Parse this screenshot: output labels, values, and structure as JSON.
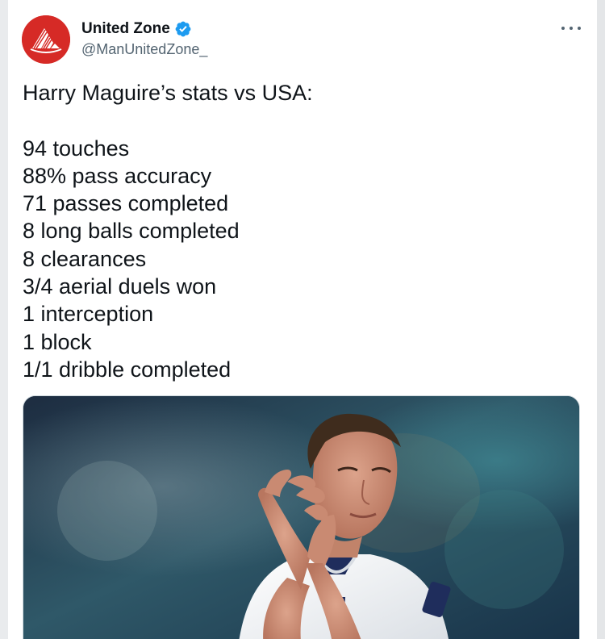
{
  "tweet": {
    "author": {
      "display_name": "United Zone",
      "handle": "@ManUnitedZone_",
      "verified": true,
      "avatar_color": "#d62a26"
    },
    "text": "Harry Maguire’s stats vs USA:\n\n94 touches\n88% pass accuracy\n71 passes completed\n8 long balls completed\n8 clearances\n3/4 aerial duels won\n1 interception\n1 block\n1/1 dribble completed",
    "media": {
      "icon": "photo-icon"
    }
  },
  "icons": {
    "more": "more-horizontal-icon",
    "verified": "verified-badge-icon"
  },
  "colors": {
    "text_primary": "#0f1419",
    "text_secondary": "#536471",
    "verified_blue": "#1d9bf0",
    "card_border": "#cfd9de"
  }
}
